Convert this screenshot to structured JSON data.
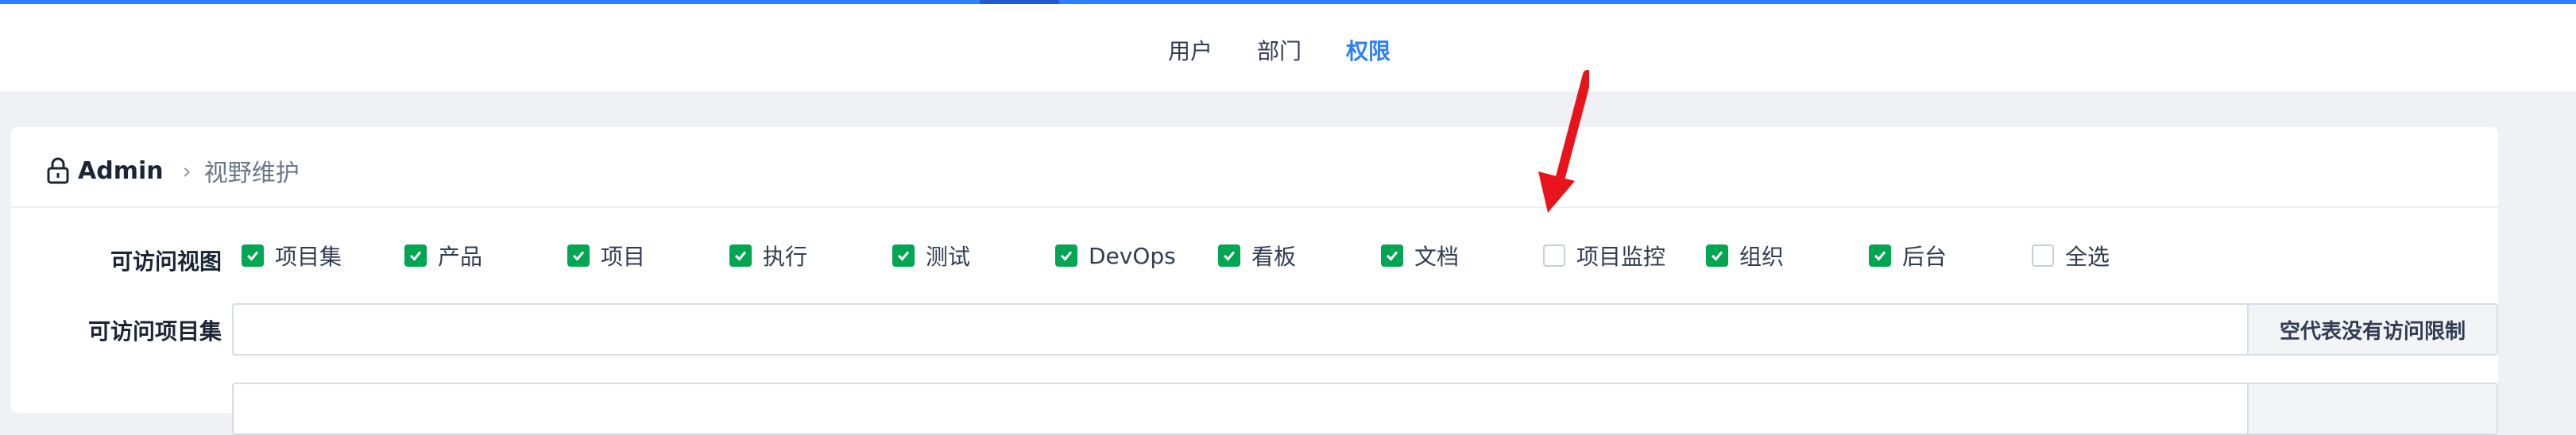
{
  "nav": {
    "items": [
      "用户",
      "部门",
      "权限"
    ]
  },
  "breadcrumb": {
    "root": "Admin",
    "separator": "›",
    "current": "视野维护"
  },
  "views": {
    "label": "可访问视图",
    "options": [
      {
        "label": "项目集",
        "checked": true
      },
      {
        "label": "产品",
        "checked": true
      },
      {
        "label": "项目",
        "checked": true
      },
      {
        "label": "执行",
        "checked": true
      },
      {
        "label": "测试",
        "checked": true
      },
      {
        "label": "DevOps",
        "checked": true
      },
      {
        "label": "看板",
        "checked": true
      },
      {
        "label": "文档",
        "checked": true
      },
      {
        "label": "项目监控",
        "checked": false
      },
      {
        "label": "组织",
        "checked": true
      },
      {
        "label": "后台",
        "checked": true
      },
      {
        "label": "全选",
        "checked": false
      }
    ]
  },
  "programs": {
    "label": "可访问项目集",
    "value": "",
    "addon": "空代表没有访问限制"
  },
  "colors": {
    "accent": "#2e7fff",
    "check": "#00a651",
    "arrow": "#e8141b"
  }
}
